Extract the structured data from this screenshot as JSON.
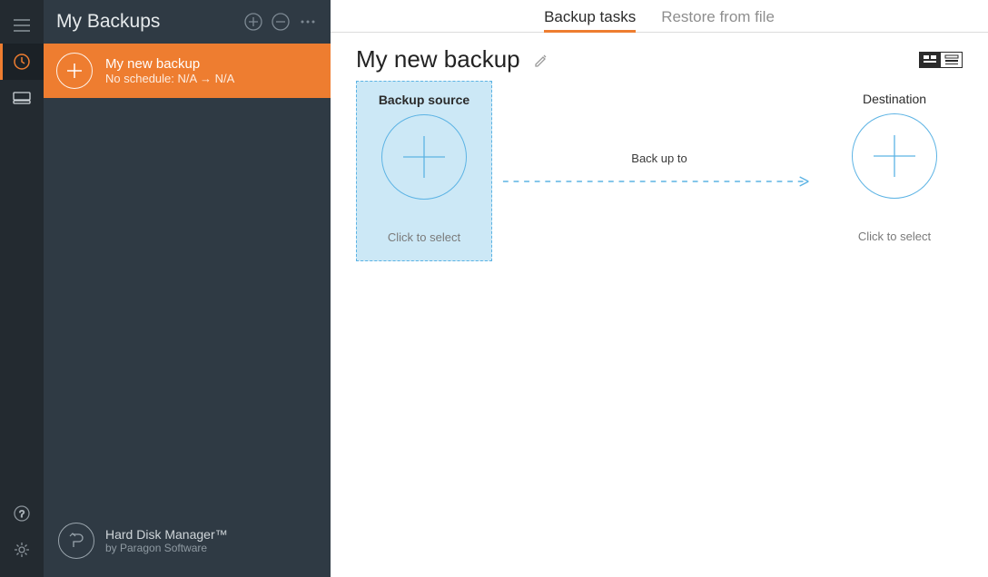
{
  "sidebar": {
    "title": "My Backups",
    "item": {
      "title": "My new backup",
      "subtitle": "No schedule: N/A → N/A"
    },
    "footer": {
      "title": "Hard Disk Manager™",
      "subtitle": "by Paragon Software"
    }
  },
  "tabs": {
    "backup": "Backup tasks",
    "restore": "Restore from file"
  },
  "page": {
    "title": "My new backup"
  },
  "source": {
    "title": "Backup source",
    "hint": "Click to select"
  },
  "arrow": {
    "label": "Back up to"
  },
  "destination": {
    "title": "Destination",
    "hint": "Click to select"
  }
}
